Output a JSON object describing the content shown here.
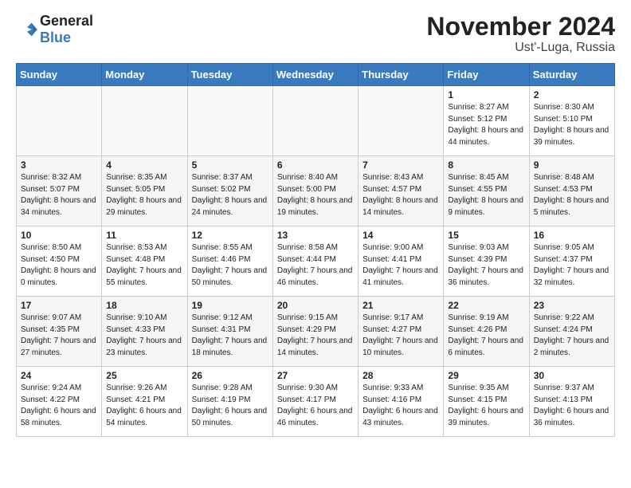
{
  "header": {
    "logo_line1": "General",
    "logo_line2": "Blue",
    "month_title": "November 2024",
    "location": "Ust'-Luga, Russia"
  },
  "weekdays": [
    "Sunday",
    "Monday",
    "Tuesday",
    "Wednesday",
    "Thursday",
    "Friday",
    "Saturday"
  ],
  "weeks": [
    [
      {
        "day": "",
        "info": ""
      },
      {
        "day": "",
        "info": ""
      },
      {
        "day": "",
        "info": ""
      },
      {
        "day": "",
        "info": ""
      },
      {
        "day": "",
        "info": ""
      },
      {
        "day": "1",
        "info": "Sunrise: 8:27 AM\nSunset: 5:12 PM\nDaylight: 8 hours\nand 44 minutes."
      },
      {
        "day": "2",
        "info": "Sunrise: 8:30 AM\nSunset: 5:10 PM\nDaylight: 8 hours\nand 39 minutes."
      }
    ],
    [
      {
        "day": "3",
        "info": "Sunrise: 8:32 AM\nSunset: 5:07 PM\nDaylight: 8 hours\nand 34 minutes."
      },
      {
        "day": "4",
        "info": "Sunrise: 8:35 AM\nSunset: 5:05 PM\nDaylight: 8 hours\nand 29 minutes."
      },
      {
        "day": "5",
        "info": "Sunrise: 8:37 AM\nSunset: 5:02 PM\nDaylight: 8 hours\nand 24 minutes."
      },
      {
        "day": "6",
        "info": "Sunrise: 8:40 AM\nSunset: 5:00 PM\nDaylight: 8 hours\nand 19 minutes."
      },
      {
        "day": "7",
        "info": "Sunrise: 8:43 AM\nSunset: 4:57 PM\nDaylight: 8 hours\nand 14 minutes."
      },
      {
        "day": "8",
        "info": "Sunrise: 8:45 AM\nSunset: 4:55 PM\nDaylight: 8 hours\nand 9 minutes."
      },
      {
        "day": "9",
        "info": "Sunrise: 8:48 AM\nSunset: 4:53 PM\nDaylight: 8 hours\nand 5 minutes."
      }
    ],
    [
      {
        "day": "10",
        "info": "Sunrise: 8:50 AM\nSunset: 4:50 PM\nDaylight: 8 hours\nand 0 minutes."
      },
      {
        "day": "11",
        "info": "Sunrise: 8:53 AM\nSunset: 4:48 PM\nDaylight: 7 hours\nand 55 minutes."
      },
      {
        "day": "12",
        "info": "Sunrise: 8:55 AM\nSunset: 4:46 PM\nDaylight: 7 hours\nand 50 minutes."
      },
      {
        "day": "13",
        "info": "Sunrise: 8:58 AM\nSunset: 4:44 PM\nDaylight: 7 hours\nand 46 minutes."
      },
      {
        "day": "14",
        "info": "Sunrise: 9:00 AM\nSunset: 4:41 PM\nDaylight: 7 hours\nand 41 minutes."
      },
      {
        "day": "15",
        "info": "Sunrise: 9:03 AM\nSunset: 4:39 PM\nDaylight: 7 hours\nand 36 minutes."
      },
      {
        "day": "16",
        "info": "Sunrise: 9:05 AM\nSunset: 4:37 PM\nDaylight: 7 hours\nand 32 minutes."
      }
    ],
    [
      {
        "day": "17",
        "info": "Sunrise: 9:07 AM\nSunset: 4:35 PM\nDaylight: 7 hours\nand 27 minutes."
      },
      {
        "day": "18",
        "info": "Sunrise: 9:10 AM\nSunset: 4:33 PM\nDaylight: 7 hours\nand 23 minutes."
      },
      {
        "day": "19",
        "info": "Sunrise: 9:12 AM\nSunset: 4:31 PM\nDaylight: 7 hours\nand 18 minutes."
      },
      {
        "day": "20",
        "info": "Sunrise: 9:15 AM\nSunset: 4:29 PM\nDaylight: 7 hours\nand 14 minutes."
      },
      {
        "day": "21",
        "info": "Sunrise: 9:17 AM\nSunset: 4:27 PM\nDaylight: 7 hours\nand 10 minutes."
      },
      {
        "day": "22",
        "info": "Sunrise: 9:19 AM\nSunset: 4:26 PM\nDaylight: 7 hours\nand 6 minutes."
      },
      {
        "day": "23",
        "info": "Sunrise: 9:22 AM\nSunset: 4:24 PM\nDaylight: 7 hours\nand 2 minutes."
      }
    ],
    [
      {
        "day": "24",
        "info": "Sunrise: 9:24 AM\nSunset: 4:22 PM\nDaylight: 6 hours\nand 58 minutes."
      },
      {
        "day": "25",
        "info": "Sunrise: 9:26 AM\nSunset: 4:21 PM\nDaylight: 6 hours\nand 54 minutes."
      },
      {
        "day": "26",
        "info": "Sunrise: 9:28 AM\nSunset: 4:19 PM\nDaylight: 6 hours\nand 50 minutes."
      },
      {
        "day": "27",
        "info": "Sunrise: 9:30 AM\nSunset: 4:17 PM\nDaylight: 6 hours\nand 46 minutes."
      },
      {
        "day": "28",
        "info": "Sunrise: 9:33 AM\nSunset: 4:16 PM\nDaylight: 6 hours\nand 43 minutes."
      },
      {
        "day": "29",
        "info": "Sunrise: 9:35 AM\nSunset: 4:15 PM\nDaylight: 6 hours\nand 39 minutes."
      },
      {
        "day": "30",
        "info": "Sunrise: 9:37 AM\nSunset: 4:13 PM\nDaylight: 6 hours\nand 36 minutes."
      }
    ]
  ]
}
